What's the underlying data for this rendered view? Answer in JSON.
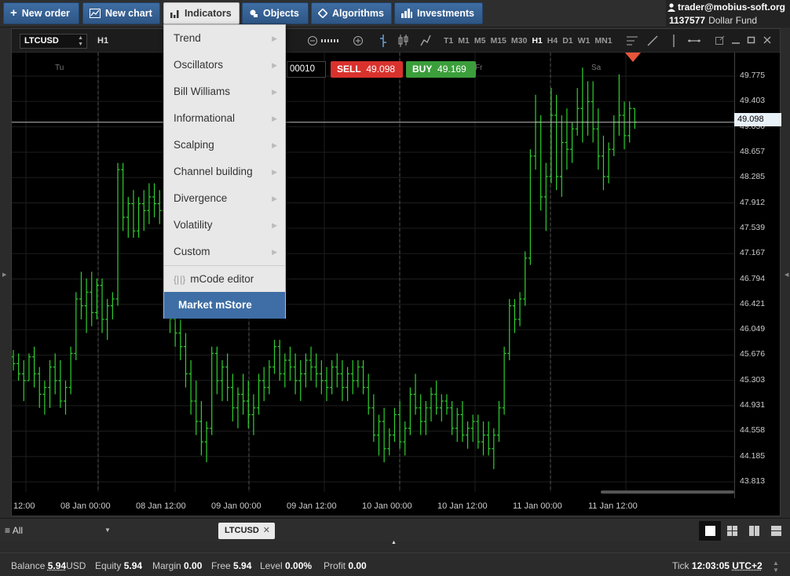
{
  "toolbar": {
    "new_order": "New order",
    "new_chart": "New chart",
    "indicators": "Indicators",
    "objects": "Objects",
    "algorithms": "Algorithms",
    "investments": "Investments"
  },
  "account": {
    "user": "trader@mobius-soft.org",
    "number": "1137577",
    "fund": "Dollar Fund"
  },
  "chart": {
    "symbol": "LTCUSD",
    "timeframe": "H1",
    "timeframes": [
      "T1",
      "M1",
      "M5",
      "M15",
      "M30",
      "H1",
      "H4",
      "D1",
      "W1",
      "MN1"
    ],
    "active_timeframe": "H1",
    "quantity": "00010",
    "sell_label": "SELL",
    "sell_price": "49.098",
    "buy_label": "BUY",
    "buy_price": "49.169",
    "current_price": "49.098",
    "day_labels": [
      "Tu",
      "Fr",
      "Sa"
    ]
  },
  "indicators_menu": {
    "items": [
      "Trend",
      "Oscillators",
      "Bill Williams",
      "Informational",
      "Scalping",
      "Channel building",
      "Divergence",
      "Volatility",
      "Custom"
    ],
    "mcode": "mCode editor",
    "store": "Market mStore"
  },
  "tabbar": {
    "filter": "All",
    "tab": "LTCUSD"
  },
  "status": {
    "balance_label": "Balance",
    "balance": "5.94",
    "balance_cur": "USD",
    "equity_label": "Equity",
    "equity": "5.94",
    "margin_label": "Margin",
    "margin": "0.00",
    "free_label": "Free",
    "free": "5.94",
    "level_label": "Level",
    "level": "0.00%",
    "profit_label": "Profit",
    "profit": "0.00",
    "tick_label": "Tick",
    "tick": "12:03:05",
    "tz": "UTC+2"
  },
  "colors": {
    "candle": "#2fd02f",
    "sell": "#e0302c",
    "buy": "#3aa63a",
    "accent": "#3e6ea5"
  },
  "chart_data": {
    "type": "ohlc",
    "yticks": [
      "49.775",
      "49.403",
      "49.030",
      "48.657",
      "48.285",
      "47.912",
      "47.539",
      "47.167",
      "46.794",
      "46.421",
      "46.049",
      "45.676",
      "45.303",
      "44.931",
      "44.558",
      "44.185",
      "43.813"
    ],
    "ylim": [
      43.6,
      50.0
    ],
    "xticks": [
      "12:00",
      "08 Jan 00:00",
      "08 Jan 12:00",
      "09 Jan 00:00",
      "09 Jan 12:00",
      "10 Jan 00:00",
      "10 Jan 12:00",
      "11 Jan 00:00",
      "11 Jan 12:00"
    ],
    "price_line": 49.098,
    "bars": [
      [
        45.65,
        45.75,
        45.45,
        45.55
      ],
      [
        45.55,
        45.7,
        45.3,
        45.4
      ],
      [
        45.4,
        45.6,
        45.0,
        45.3
      ],
      [
        45.3,
        45.7,
        45.3,
        45.65
      ],
      [
        45.65,
        45.8,
        45.2,
        45.4
      ],
      [
        45.4,
        45.5,
        44.9,
        45.1
      ],
      [
        45.1,
        45.3,
        44.8,
        45.2
      ],
      [
        45.2,
        45.6,
        44.9,
        45.5
      ],
      [
        45.5,
        45.7,
        45.1,
        45.3
      ],
      [
        45.3,
        45.6,
        44.9,
        45.0
      ],
      [
        45.0,
        45.3,
        44.8,
        45.2
      ],
      [
        45.2,
        45.8,
        45.1,
        45.7
      ],
      [
        45.7,
        46.6,
        45.6,
        46.5
      ],
      [
        46.5,
        46.9,
        46.2,
        46.4
      ],
      [
        46.4,
        46.8,
        46.0,
        46.6
      ],
      [
        46.6,
        46.9,
        46.1,
        46.3
      ],
      [
        46.3,
        46.8,
        46.2,
        46.7
      ],
      [
        46.7,
        46.8,
        46.0,
        46.2
      ],
      [
        46.2,
        46.5,
        45.9,
        46.4
      ],
      [
        46.4,
        46.6,
        46.2,
        46.5
      ],
      [
        46.5,
        48.5,
        46.4,
        48.4
      ],
      [
        48.4,
        48.5,
        47.5,
        47.7
      ],
      [
        47.7,
        48.0,
        47.4,
        47.9
      ],
      [
        47.9,
        48.1,
        47.4,
        47.5
      ],
      [
        47.5,
        48.0,
        47.4,
        47.9
      ],
      [
        47.9,
        48.1,
        47.5,
        47.8
      ],
      [
        47.8,
        48.2,
        47.6,
        48.0
      ],
      [
        48.0,
        48.2,
        47.7,
        47.9
      ],
      [
        47.9,
        48.1,
        47.6,
        47.8
      ],
      [
        47.8,
        48.0,
        47.3,
        47.4
      ],
      [
        47.4,
        47.6,
        46.0,
        46.2
      ],
      [
        46.2,
        46.4,
        45.8,
        46.0
      ],
      [
        46.0,
        46.2,
        45.6,
        45.8
      ],
      [
        45.8,
        46.0,
        45.2,
        45.4
      ],
      [
        45.4,
        45.6,
        44.8,
        45.0
      ],
      [
        45.0,
        45.3,
        44.5,
        44.7
      ],
      [
        44.7,
        45.0,
        44.2,
        44.4
      ],
      [
        44.4,
        44.7,
        44.1,
        44.6
      ],
      [
        44.6,
        45.8,
        44.5,
        45.7
      ],
      [
        45.7,
        45.8,
        45.1,
        45.3
      ],
      [
        45.3,
        45.6,
        45.0,
        45.5
      ],
      [
        45.5,
        45.7,
        45.0,
        45.2
      ],
      [
        45.2,
        45.4,
        44.7,
        44.9
      ],
      [
        44.9,
        45.2,
        44.6,
        45.1
      ],
      [
        45.1,
        45.4,
        44.8,
        45.0
      ],
      [
        45.0,
        45.3,
        44.6,
        44.8
      ],
      [
        44.8,
        45.1,
        44.5,
        44.9
      ],
      [
        44.9,
        45.4,
        44.8,
        45.3
      ],
      [
        45.3,
        45.5,
        45.0,
        45.2
      ],
      [
        45.2,
        45.6,
        45.1,
        45.5
      ],
      [
        45.5,
        45.9,
        45.4,
        45.8
      ],
      [
        45.8,
        45.9,
        45.3,
        45.4
      ],
      [
        45.4,
        45.7,
        45.2,
        45.6
      ],
      [
        45.6,
        45.8,
        45.3,
        45.5
      ],
      [
        45.5,
        45.7,
        45.1,
        45.3
      ],
      [
        45.3,
        45.6,
        45.0,
        45.4
      ],
      [
        45.4,
        45.7,
        45.2,
        45.6
      ],
      [
        45.6,
        45.8,
        45.3,
        45.5
      ],
      [
        45.5,
        45.7,
        45.2,
        45.4
      ],
      [
        45.4,
        45.6,
        45.1,
        45.3
      ],
      [
        45.3,
        45.5,
        45.0,
        45.2
      ],
      [
        45.2,
        45.6,
        45.1,
        45.5
      ],
      [
        45.5,
        45.7,
        45.2,
        45.4
      ],
      [
        45.4,
        45.6,
        45.0,
        45.2
      ],
      [
        45.2,
        45.5,
        45.0,
        45.4
      ],
      [
        45.4,
        45.6,
        45.1,
        45.3
      ],
      [
        45.3,
        45.6,
        45.2,
        45.5
      ],
      [
        45.5,
        45.6,
        45.1,
        45.2
      ],
      [
        45.2,
        45.4,
        44.8,
        44.9
      ],
      [
        44.9,
        45.1,
        44.4,
        44.5
      ],
      [
        44.5,
        44.8,
        44.2,
        44.7
      ],
      [
        44.7,
        44.9,
        44.1,
        44.3
      ],
      [
        44.3,
        44.6,
        44.2,
        44.5
      ],
      [
        44.5,
        44.9,
        44.4,
        44.8
      ],
      [
        44.8,
        45.0,
        44.3,
        44.4
      ],
      [
        44.4,
        44.7,
        44.2,
        44.6
      ],
      [
        44.6,
        45.2,
        44.5,
        45.1
      ],
      [
        45.1,
        45.4,
        44.8,
        44.9
      ],
      [
        44.9,
        45.1,
        44.5,
        44.7
      ],
      [
        44.7,
        45.0,
        44.5,
        44.9
      ],
      [
        44.9,
        45.2,
        44.7,
        45.1
      ],
      [
        45.1,
        45.3,
        44.8,
        44.9
      ],
      [
        44.9,
        45.1,
        44.7,
        45.0
      ],
      [
        45.0,
        45.1,
        44.8,
        44.9
      ],
      [
        44.9,
        45.0,
        44.5,
        44.6
      ],
      [
        44.6,
        44.9,
        44.4,
        44.8
      ],
      [
        44.8,
        45.0,
        44.4,
        44.5
      ],
      [
        44.5,
        44.7,
        44.3,
        44.6
      ],
      [
        44.6,
        44.8,
        44.4,
        44.7
      ],
      [
        44.7,
        44.8,
        44.3,
        44.4
      ],
      [
        44.4,
        44.7,
        44.2,
        44.5
      ],
      [
        44.5,
        44.7,
        44.2,
        44.3
      ],
      [
        44.3,
        44.6,
        44.0,
        44.5
      ],
      [
        44.5,
        45.0,
        44.4,
        44.9
      ],
      [
        44.9,
        45.8,
        44.8,
        45.7
      ],
      [
        45.7,
        46.5,
        45.6,
        46.4
      ],
      [
        46.4,
        46.5,
        46.0,
        46.2
      ],
      [
        46.2,
        46.6,
        46.1,
        46.5
      ],
      [
        46.5,
        47.2,
        46.4,
        47.1
      ],
      [
        47.1,
        48.7,
        47.0,
        48.6
      ],
      [
        48.6,
        49.5,
        48.4,
        49.1
      ],
      [
        49.1,
        49.2,
        47.8,
        48.0
      ],
      [
        48.0,
        48.5,
        47.5,
        48.3
      ],
      [
        48.3,
        49.6,
        48.2,
        49.2
      ],
      [
        49.2,
        49.5,
        48.1,
        48.3
      ],
      [
        48.3,
        49.2,
        48.0,
        48.8
      ],
      [
        48.8,
        49.3,
        48.4,
        48.7
      ],
      [
        48.7,
        49.1,
        48.5,
        49.0
      ],
      [
        49.0,
        49.6,
        48.9,
        49.3
      ],
      [
        49.3,
        49.9,
        48.8,
        49.1
      ],
      [
        49.1,
        49.7,
        48.9,
        49.4
      ],
      [
        49.4,
        49.7,
        48.8,
        49.0
      ],
      [
        49.0,
        49.3,
        48.4,
        48.6
      ],
      [
        48.6,
        48.9,
        48.1,
        48.3
      ],
      [
        48.3,
        48.8,
        48.2,
        48.7
      ],
      [
        48.7,
        49.2,
        48.6,
        49.1
      ],
      [
        49.1,
        49.8,
        48.9,
        49.2
      ],
      [
        49.2,
        49.4,
        48.7,
        48.9
      ],
      [
        48.9,
        49.4,
        48.8,
        49.3
      ],
      [
        49.3,
        49.3,
        49.0,
        49.1
      ]
    ]
  }
}
